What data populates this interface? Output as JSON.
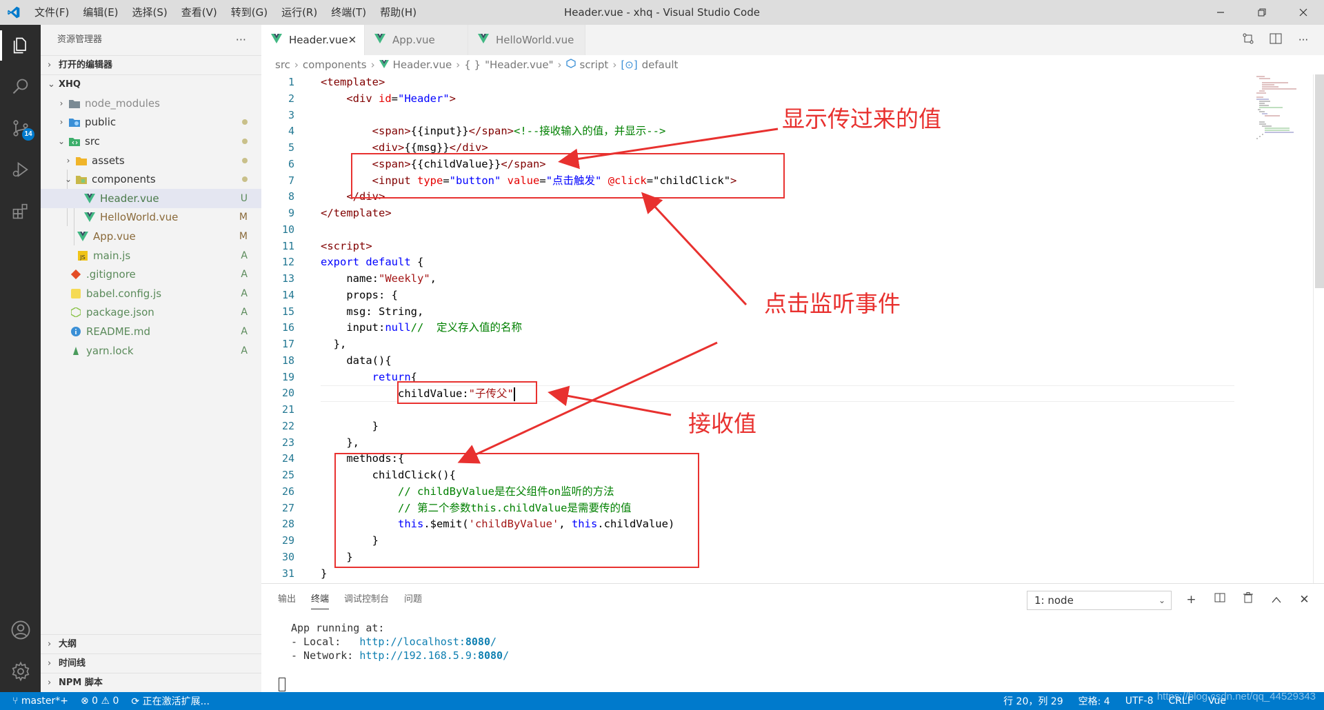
{
  "window": {
    "title": "Header.vue - xhq - Visual Studio Code",
    "menu": [
      "文件(F)",
      "编辑(E)",
      "选择(S)",
      "查看(V)",
      "转到(G)",
      "运行(R)",
      "终端(T)",
      "帮助(H)"
    ]
  },
  "activity_bar": {
    "scm_badge": "14"
  },
  "sidebar": {
    "title": "资源管理器",
    "open_editors": "打开的编辑器",
    "project": "XHQ",
    "tree": [
      {
        "name": "node_modules",
        "status": ""
      },
      {
        "name": "public",
        "status": "•"
      },
      {
        "name": "src",
        "status": "•"
      },
      {
        "name": "assets",
        "status": "•"
      },
      {
        "name": "components",
        "status": "•"
      },
      {
        "name": "Header.vue",
        "status": "U"
      },
      {
        "name": "HelloWorld.vue",
        "status": "M"
      },
      {
        "name": "App.vue",
        "status": "M"
      },
      {
        "name": "main.js",
        "status": "A"
      },
      {
        "name": ".gitignore",
        "status": "A"
      },
      {
        "name": "babel.config.js",
        "status": "A"
      },
      {
        "name": "package.json",
        "status": "A"
      },
      {
        "name": "README.md",
        "status": "A"
      },
      {
        "name": "yarn.lock",
        "status": "A"
      }
    ],
    "bottom_sections": [
      "大纲",
      "时间线",
      "NPM 脚本"
    ]
  },
  "tabs": [
    {
      "label": "Header.vue",
      "active": true
    },
    {
      "label": "App.vue",
      "active": false
    },
    {
      "label": "HelloWorld.vue",
      "active": false
    }
  ],
  "breadcrumb": [
    "src",
    "components",
    "Header.vue",
    "\"Header.vue\"",
    "script",
    "default"
  ],
  "editor": {
    "line_numbers": [
      "1",
      "2",
      "3",
      "4",
      "5",
      "6",
      "7",
      "8",
      "9",
      "10",
      "11",
      "12",
      "13",
      "14",
      "15",
      "16",
      "17",
      "18",
      "19",
      "20",
      "21",
      "22",
      "23",
      "24",
      "25",
      "26",
      "27",
      "28",
      "29",
      "30",
      "31"
    ]
  },
  "annotations": {
    "show_value": "显示传过来的值",
    "click_listener": "点击监听事件",
    "receive_value": "接收值"
  },
  "panel": {
    "tabs": [
      "输出",
      "终端",
      "调试控制台",
      "问题"
    ],
    "active_tab": "终端",
    "terminal_select": "1: node",
    "terminal_lines": {
      "l1": "App running at:",
      "l2_label": "- Local:   ",
      "l2_url": "http://localhost:",
      "l2_port": "8080",
      "l2_tail": "/",
      "l3_label": "- Network: ",
      "l3_url": "http://192.168.5.9:",
      "l3_port": "8080",
      "l3_tail": "/"
    }
  },
  "statusbar": {
    "branch": "master*+",
    "problems": "⊗ 0 ⚠ 0",
    "activity": "正在激活扩展...",
    "cursor": "行 20，列 29",
    "spaces": "空格: 4",
    "encoding": "UTF-8",
    "eol": "CRLF",
    "language": "Vue",
    "watermark": "https://blog.csdn.net/qq_44529343"
  },
  "colors": {
    "accent": "#007acc",
    "annotation_red": "#e8312f",
    "activity_bar": "#2c2c2c"
  }
}
